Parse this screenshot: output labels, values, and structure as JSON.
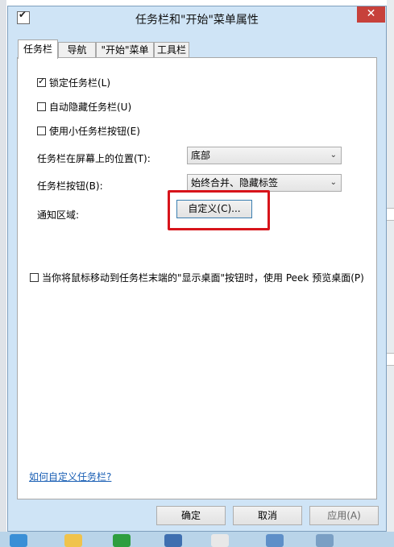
{
  "window": {
    "title": "任务栏和\"开始\"菜单属性",
    "close_glyph": "✕"
  },
  "tabs": [
    {
      "label": "任务栏",
      "active": true
    },
    {
      "label": "导航",
      "active": false
    },
    {
      "label": "\"开始\"菜单",
      "active": false
    },
    {
      "label": "工具栏",
      "active": false
    }
  ],
  "taskbar_tab": {
    "lock_taskbar": {
      "label": "锁定任务栏(L)",
      "checked": true
    },
    "auto_hide": {
      "label": "自动隐藏任务栏(U)",
      "checked": false
    },
    "small_buttons": {
      "label": "使用小任务栏按钮(E)",
      "checked": false
    },
    "position": {
      "label": "任务栏在屏幕上的位置(T):",
      "value": "底部"
    },
    "buttons": {
      "label": "任务栏按钮(B):",
      "value": "始终合并、隐藏标签"
    },
    "notification": {
      "label": "通知区域:",
      "button_label": "自定义(C)..."
    },
    "peek": {
      "label": "当你将鼠标移动到任务栏末端的\"显示桌面\"按钮时，使用 Peek 预览桌面(P)",
      "checked": false
    },
    "help_link": "如何自定义任务栏?"
  },
  "footer": {
    "ok_label": "确定",
    "cancel_label": "取消",
    "apply_label": "应用(A)"
  },
  "colors": {
    "highlight": "#d7141b",
    "close": "#c7413b",
    "frame": "#cfe4f6",
    "link": "#1a5fb4"
  }
}
